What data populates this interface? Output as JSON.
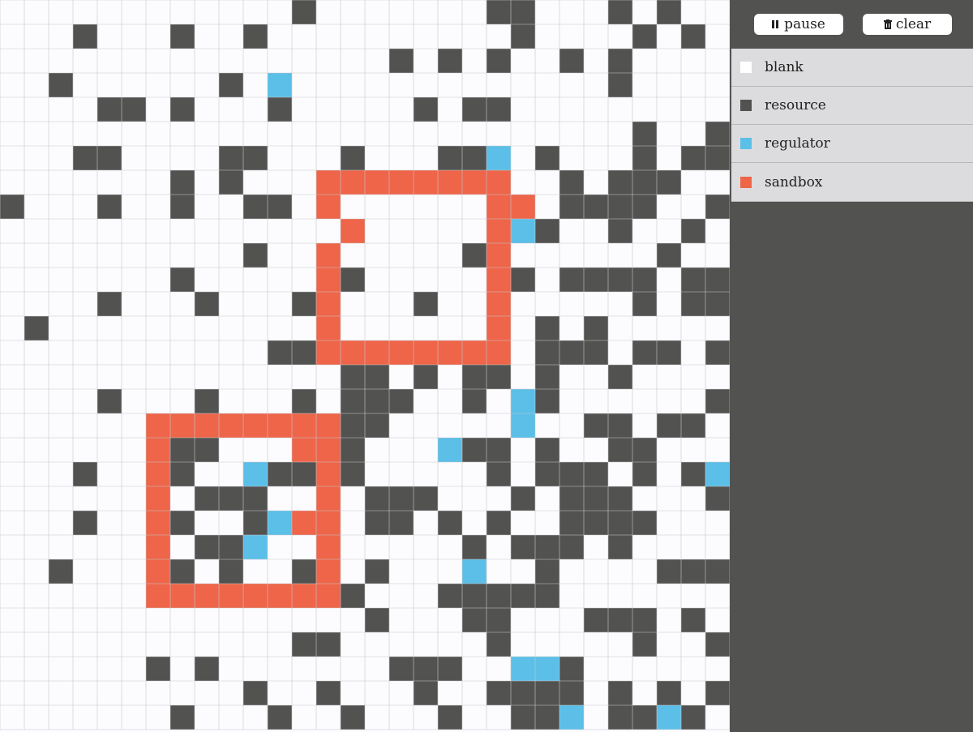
{
  "toolbar": {
    "pause_label": "pause",
    "clear_label": "clear"
  },
  "legend": [
    {
      "key": "blank",
      "label": "blank",
      "color": "#ffffff"
    },
    {
      "key": "resource",
      "label": "resource",
      "color": "#525250"
    },
    {
      "key": "regulator",
      "label": "regulator",
      "color": "#5bbfe8"
    },
    {
      "key": "sandbox",
      "label": "sandbox",
      "color": "#ee6549"
    }
  ],
  "colors": {
    "blank": "#fcfcfe",
    "grid_line": "#c8c8cc",
    "resource": "#525250",
    "regulator": "#5bbfe8",
    "sandbox": "#ee6549"
  },
  "grid": {
    "cols": 30,
    "rows": 30,
    "cells": [
      "............#.......##...#.#..",
      "...#...#..#..........#....#.#.",
      "................#.#.#..#.#....",
      "..#......#.R.............#....",
      "....##.#...#.....#.##.........",
      "..........................#..#",
      "...##....##...#...##R.#...#.##",
      ".......#.#...SSSSSSSS..#.###..",
      "#...#..#..##.S......SS.####..#",
      "..............S.....SR#..#..#.",
      "..........#..S.....#S......#..",
      ".......#.....S#.....S#.####.##",
      "....#...#...#S...#..S.....#.##",
      ".#...........S......S.#.#.....",
      "...........##SSSSSSSS.###.##.#",
      "..............##.#.##.#..#....",
      "....#...#...#.###..#.R#......#",
      "......SSSSSSSS##.....R..##.##.",
      "......S##...SS#...R##.#..##...",
      "...#..S#..R##S#.....#.###.#.#R",
      "......S.###..S.###...#.###...#",
      "...#..S#..#RSS.##.#.#..####...",
      "......S.##R..S.....#.###.#....",
      "..#...S#.#..#S.#...R..#....###",
      "......SSSSSSSS#...#####.......##",
      "...............#...##...###.#.",
      "............##......#.....#..#",
      "......#.#.......###..RR#......",
      "..........#..#...#..####.#.#.#",
      ".......#...#..#...#..##R.##R#."
    ]
  }
}
